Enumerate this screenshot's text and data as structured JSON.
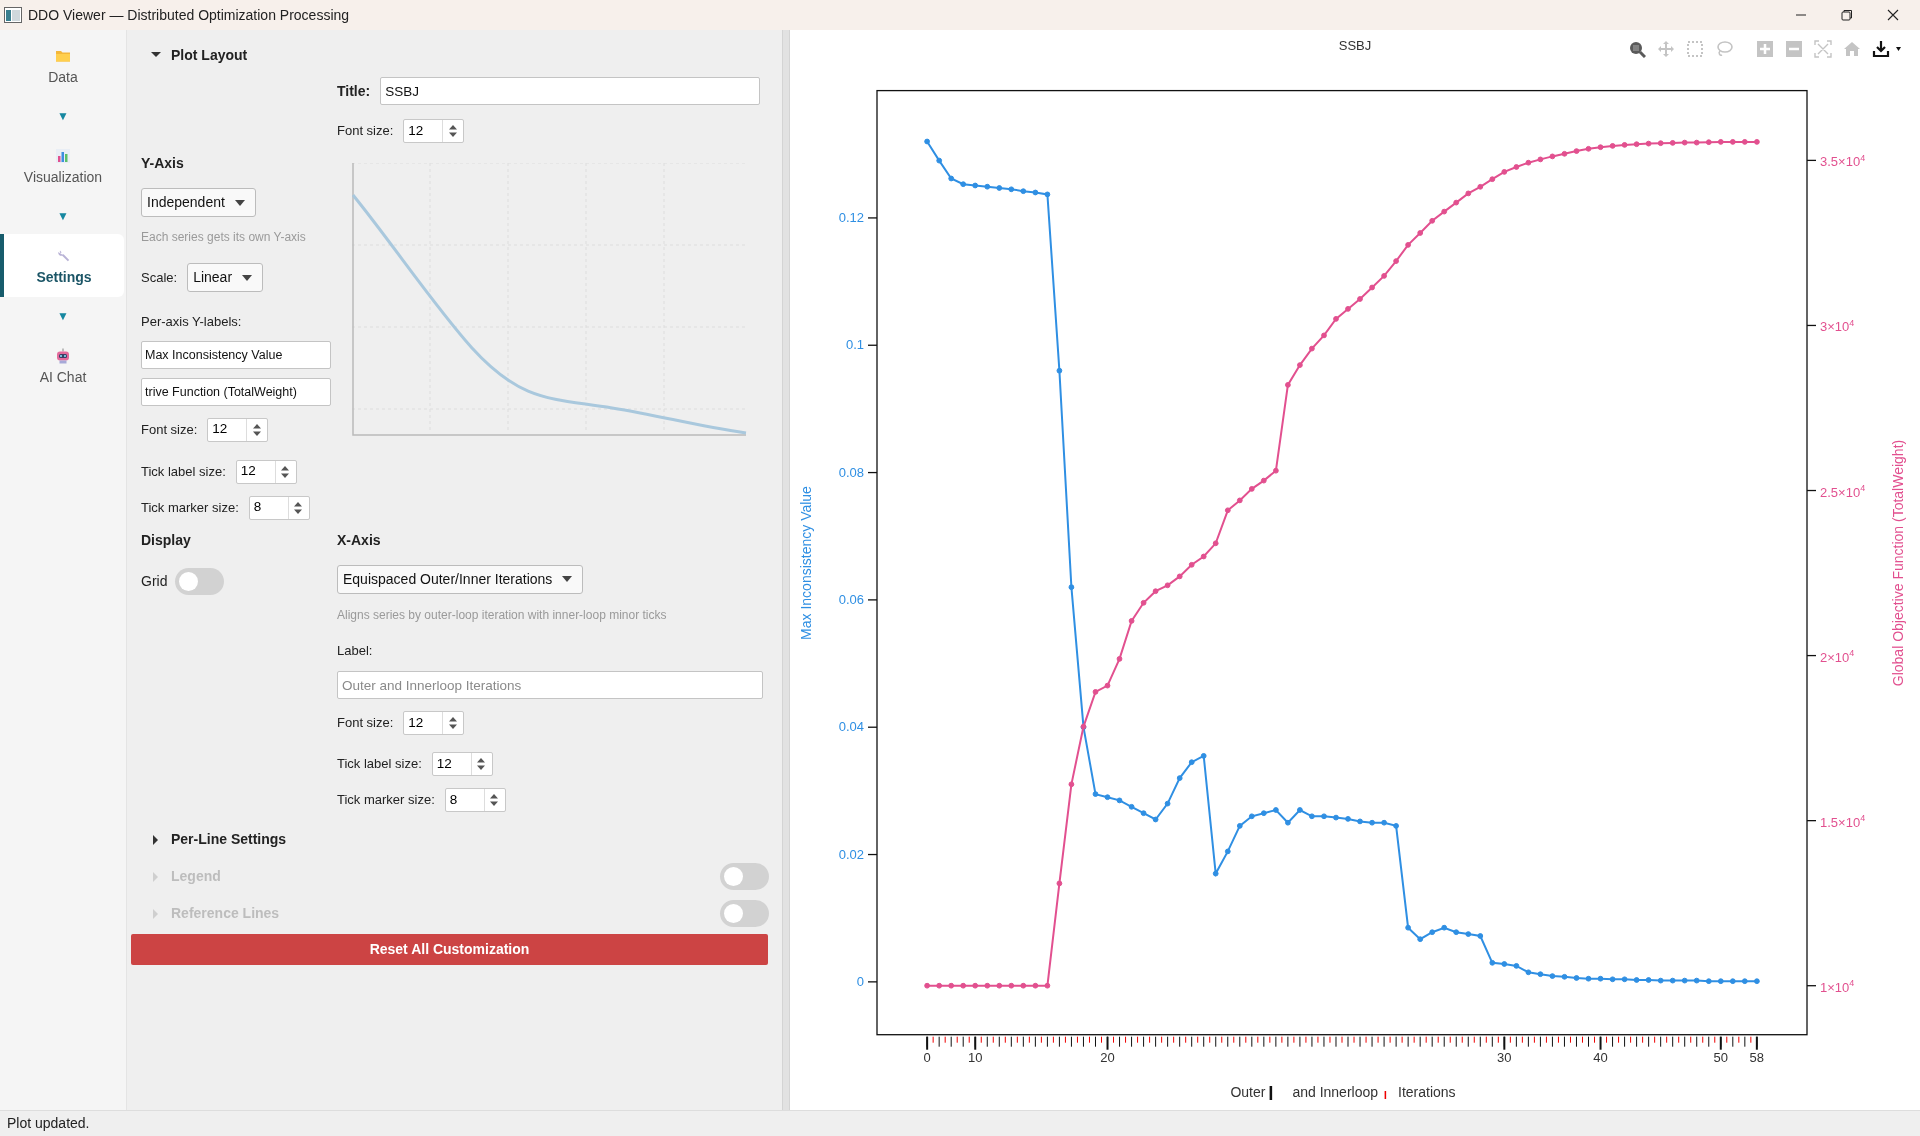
{
  "window": {
    "title": "DDO Viewer — Distributed Optimization Processing"
  },
  "sidebar": {
    "items": [
      {
        "kind": "folder",
        "label": "Data",
        "selected": false
      },
      {
        "kind": "arrow",
        "glyph": "▼"
      },
      {
        "kind": "bar-chart",
        "label": "Visualization",
        "selected": false
      },
      {
        "kind": "arrow",
        "glyph": "▼"
      },
      {
        "kind": "wrench",
        "label": "Settings",
        "selected": true
      },
      {
        "kind": "arrow",
        "glyph": "▼"
      },
      {
        "kind": "robot",
        "label": "AI Chat",
        "selected": false
      }
    ]
  },
  "settings": {
    "plot_layout": {
      "title": "Plot Layout",
      "expanded": true,
      "title_label": "Title:",
      "title_value": "SSBJ",
      "font_size_label": "Font size:",
      "font_size": "12"
    },
    "y_axis": {
      "heading": "Y-Axis",
      "mode": "Independent",
      "hint": "Each series gets its own Y-axis",
      "scale_label": "Scale:",
      "scale": "Linear",
      "labels_heading": "Per-axis Y-labels:",
      "labels": [
        "Max Inconsistency Value",
        "trive Function (TotalWeight)"
      ],
      "spinners": [
        {
          "label": "Font size:",
          "value": "12"
        },
        {
          "label": "Tick label size:",
          "value": "12"
        },
        {
          "label": "Tick marker size:",
          "value": "8"
        }
      ]
    },
    "display": {
      "heading": "Display",
      "grid_label": "Grid",
      "grid_on": false
    },
    "x_axis": {
      "heading": "X-Axis",
      "mode": "Equispaced Outer/Inner Iterations",
      "hint": "Aligns series by outer-loop iteration with inner-loop minor ticks",
      "label_caption": "Label:",
      "label_placeholder": "Outer and Innerloop Iterations",
      "spinners": [
        {
          "label": "Font size:",
          "value": "12"
        },
        {
          "label": "Tick label size:",
          "value": "12"
        },
        {
          "label": "Tick marker size:",
          "value": "8"
        }
      ]
    },
    "sections": [
      {
        "title": "Per-Line Settings",
        "expanded": false,
        "disabled": false
      },
      {
        "title": "Legend",
        "expanded": false,
        "disabled": true,
        "toggle_on": false
      },
      {
        "title": "Reference Lines",
        "expanded": false,
        "disabled": true,
        "toggle_on": false
      }
    ],
    "reset_button": "Reset All Customization"
  },
  "plot": {
    "drag_tools": [
      {
        "kind": "zoom",
        "selected": true
      },
      {
        "kind": "pan",
        "selected": false
      },
      {
        "kind": "box-select",
        "selected": false
      },
      {
        "kind": "lasso",
        "selected": false
      }
    ],
    "actions": [
      {
        "kind": "zoom-in"
      },
      {
        "kind": "zoom-out"
      },
      {
        "kind": "autoscale"
      },
      {
        "kind": "home"
      },
      {
        "kind": "download"
      }
    ],
    "x_axis_label": [
      {
        "text": "Outer",
        "kind": "major"
      },
      {
        "text": "and Innerloop",
        "kind": "minor"
      },
      {
        "text": "Iterations",
        "kind": "plain"
      }
    ],
    "chart_data": {
      "type": "line",
      "title": "SSBJ",
      "ylabel": "Max Inconsistency Value",
      "y2label": "Global Objective Function (TotalWeight)",
      "categories": [
        "0",
        null,
        null,
        null,
        "10",
        null,
        null,
        null,
        null,
        null,
        null,
        null,
        null,
        null,
        null,
        "20",
        null,
        null,
        null,
        null,
        null,
        null,
        null,
        null,
        null,
        null,
        null,
        null,
        null,
        null,
        null,
        null,
        null,
        null,
        null,
        null,
        null,
        null,
        null,
        null,
        null,
        null,
        null,
        null,
        null,
        null,
        null,
        null,
        "30",
        null,
        null,
        null,
        null,
        null,
        null,
        null,
        "40",
        null,
        null,
        null,
        null,
        null,
        null,
        null,
        null,
        null,
        "50",
        null,
        null,
        "58"
      ],
      "series": [
        {
          "color": "#2f8fe3",
          "marker": "circle",
          "values": [
            0.132,
            0.129,
            0.1262,
            0.1253,
            0.1251,
            0.1249,
            0.1247,
            0.1245,
            0.1242,
            0.124,
            0.1237,
            0.096,
            0.062,
            0.04,
            0.0295,
            0.029,
            0.0285,
            0.0275,
            0.0265,
            0.0255,
            0.028,
            0.032,
            0.0345,
            0.0355,
            0.017,
            0.0205,
            0.0245,
            0.026,
            0.0265,
            0.027,
            0.025,
            0.027,
            0.026,
            0.026,
            0.0258,
            0.0256,
            0.0252,
            0.025,
            0.025,
            0.0245,
            0.0085,
            0.0067,
            0.0078,
            0.0085,
            0.0078,
            0.0075,
            0.0072,
            0.003,
            0.0028,
            0.0025,
            0.0015,
            0.0012,
            0.0009,
            0.0008,
            0.0006,
            0.0005,
            0.0005,
            0.0004,
            0.0004,
            0.0003,
            0.0003,
            0.0002,
            0.0002,
            0.0002,
            0.0002,
            0.0001,
            0.0001,
            0.0001,
            0.0001,
            0.0001
          ]
        },
        {
          "color": "#e2508f",
          "axis": "y2",
          "marker": "circle",
          "values": [
            10000,
            10000,
            10000,
            10000,
            10000,
            10000,
            10000,
            10000,
            10000,
            10000,
            10000,
            13100,
            16100,
            17850,
            18900,
            19090,
            19900,
            21050,
            21600,
            21950,
            22130,
            22400,
            22750,
            23000,
            23400,
            24400,
            24700,
            25050,
            25300,
            25600,
            28200,
            28800,
            29300,
            29700,
            30200,
            30500,
            30800,
            31150,
            31500,
            31950,
            32440,
            32800,
            33170,
            33450,
            33720,
            34000,
            34200,
            34430,
            34650,
            34800,
            34930,
            35030,
            35120,
            35200,
            35280,
            35350,
            35400,
            35440,
            35470,
            35490,
            35510,
            35520,
            35530,
            35540,
            35540,
            35550,
            35560,
            35560,
            35560,
            35560
          ]
        }
      ],
      "ylim": [
        -0.0083,
        0.14
      ],
      "y2lim": [
        8516,
        37114
      ],
      "yticks": [
        {
          "value": 0,
          "label": "0"
        },
        {
          "value": 0.02,
          "label": "0.02"
        },
        {
          "value": 0.04,
          "label": "0.04"
        },
        {
          "value": 0.06,
          "label": "0.06"
        },
        {
          "value": 0.08,
          "label": "0.08"
        },
        {
          "value": 0.1,
          "label": "0.1"
        },
        {
          "value": 0.12,
          "label": "0.12"
        }
      ],
      "y2ticks": [
        {
          "value": 10000,
          "label": "1×10$^{4}$"
        },
        {
          "value": 15000,
          "label": "1.5×10$^{4}$"
        },
        {
          "value": 20000,
          "label": "2×10$^{4}$"
        },
        {
          "value": 25000,
          "label": "2.5×10$^{4}$"
        },
        {
          "value": 30000,
          "label": "3×10$^{4}$"
        },
        {
          "value": 35000,
          "label": "3.5×10$^{4}$"
        }
      ]
    }
  },
  "status_bar": "Plot updated."
}
